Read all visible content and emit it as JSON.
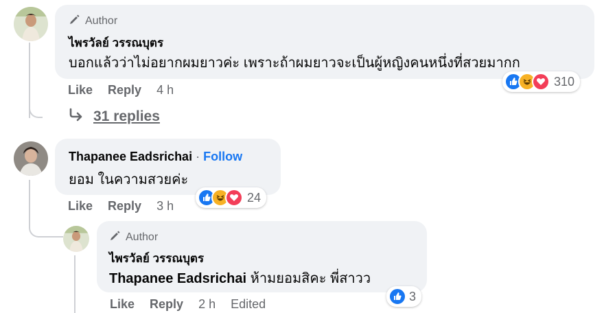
{
  "comments": [
    {
      "author_tag": "Author",
      "name": "ไพรวัลย์ วรรณบุตร",
      "text": "บอกแล้วว่าไม่อยากผมยาวค่ะ เพราะถ้าผมยาวจะเป็นผู้หญิงคนหนึ่งที่สวยมากก",
      "like_label": "Like",
      "reply_label": "Reply",
      "time": "4 h",
      "reaction_count": "310",
      "reactions": [
        "like",
        "haha",
        "love"
      ]
    },
    {
      "name": "Thapanee Eadsrichai",
      "separator": "·",
      "follow_label": "Follow",
      "text": "ยอม ในความสวยค่ะ",
      "like_label": "Like",
      "reply_label": "Reply",
      "time": "3 h",
      "reaction_count": "24",
      "reactions": [
        "like",
        "haha",
        "love"
      ]
    },
    {
      "author_tag": "Author",
      "name": "ไพรวัลย์ วรรณบุตร",
      "mention": "Thapanee Eadsrichai",
      "text": " ห้ามยอมสิคะ พี่สาวว",
      "like_label": "Like",
      "reply_label": "Reply",
      "time": "2 h",
      "edited_label": "Edited",
      "reaction_count": "3",
      "reactions": [
        "like"
      ]
    }
  ],
  "view_replies": {
    "label": "31 replies",
    "icon": "reply-arrow-icon"
  },
  "colors": {
    "like": "#1877f2",
    "haha": "#f7b125",
    "love": "#f33e58",
    "bubble": "#f0f2f5",
    "link": "#1877f2"
  }
}
